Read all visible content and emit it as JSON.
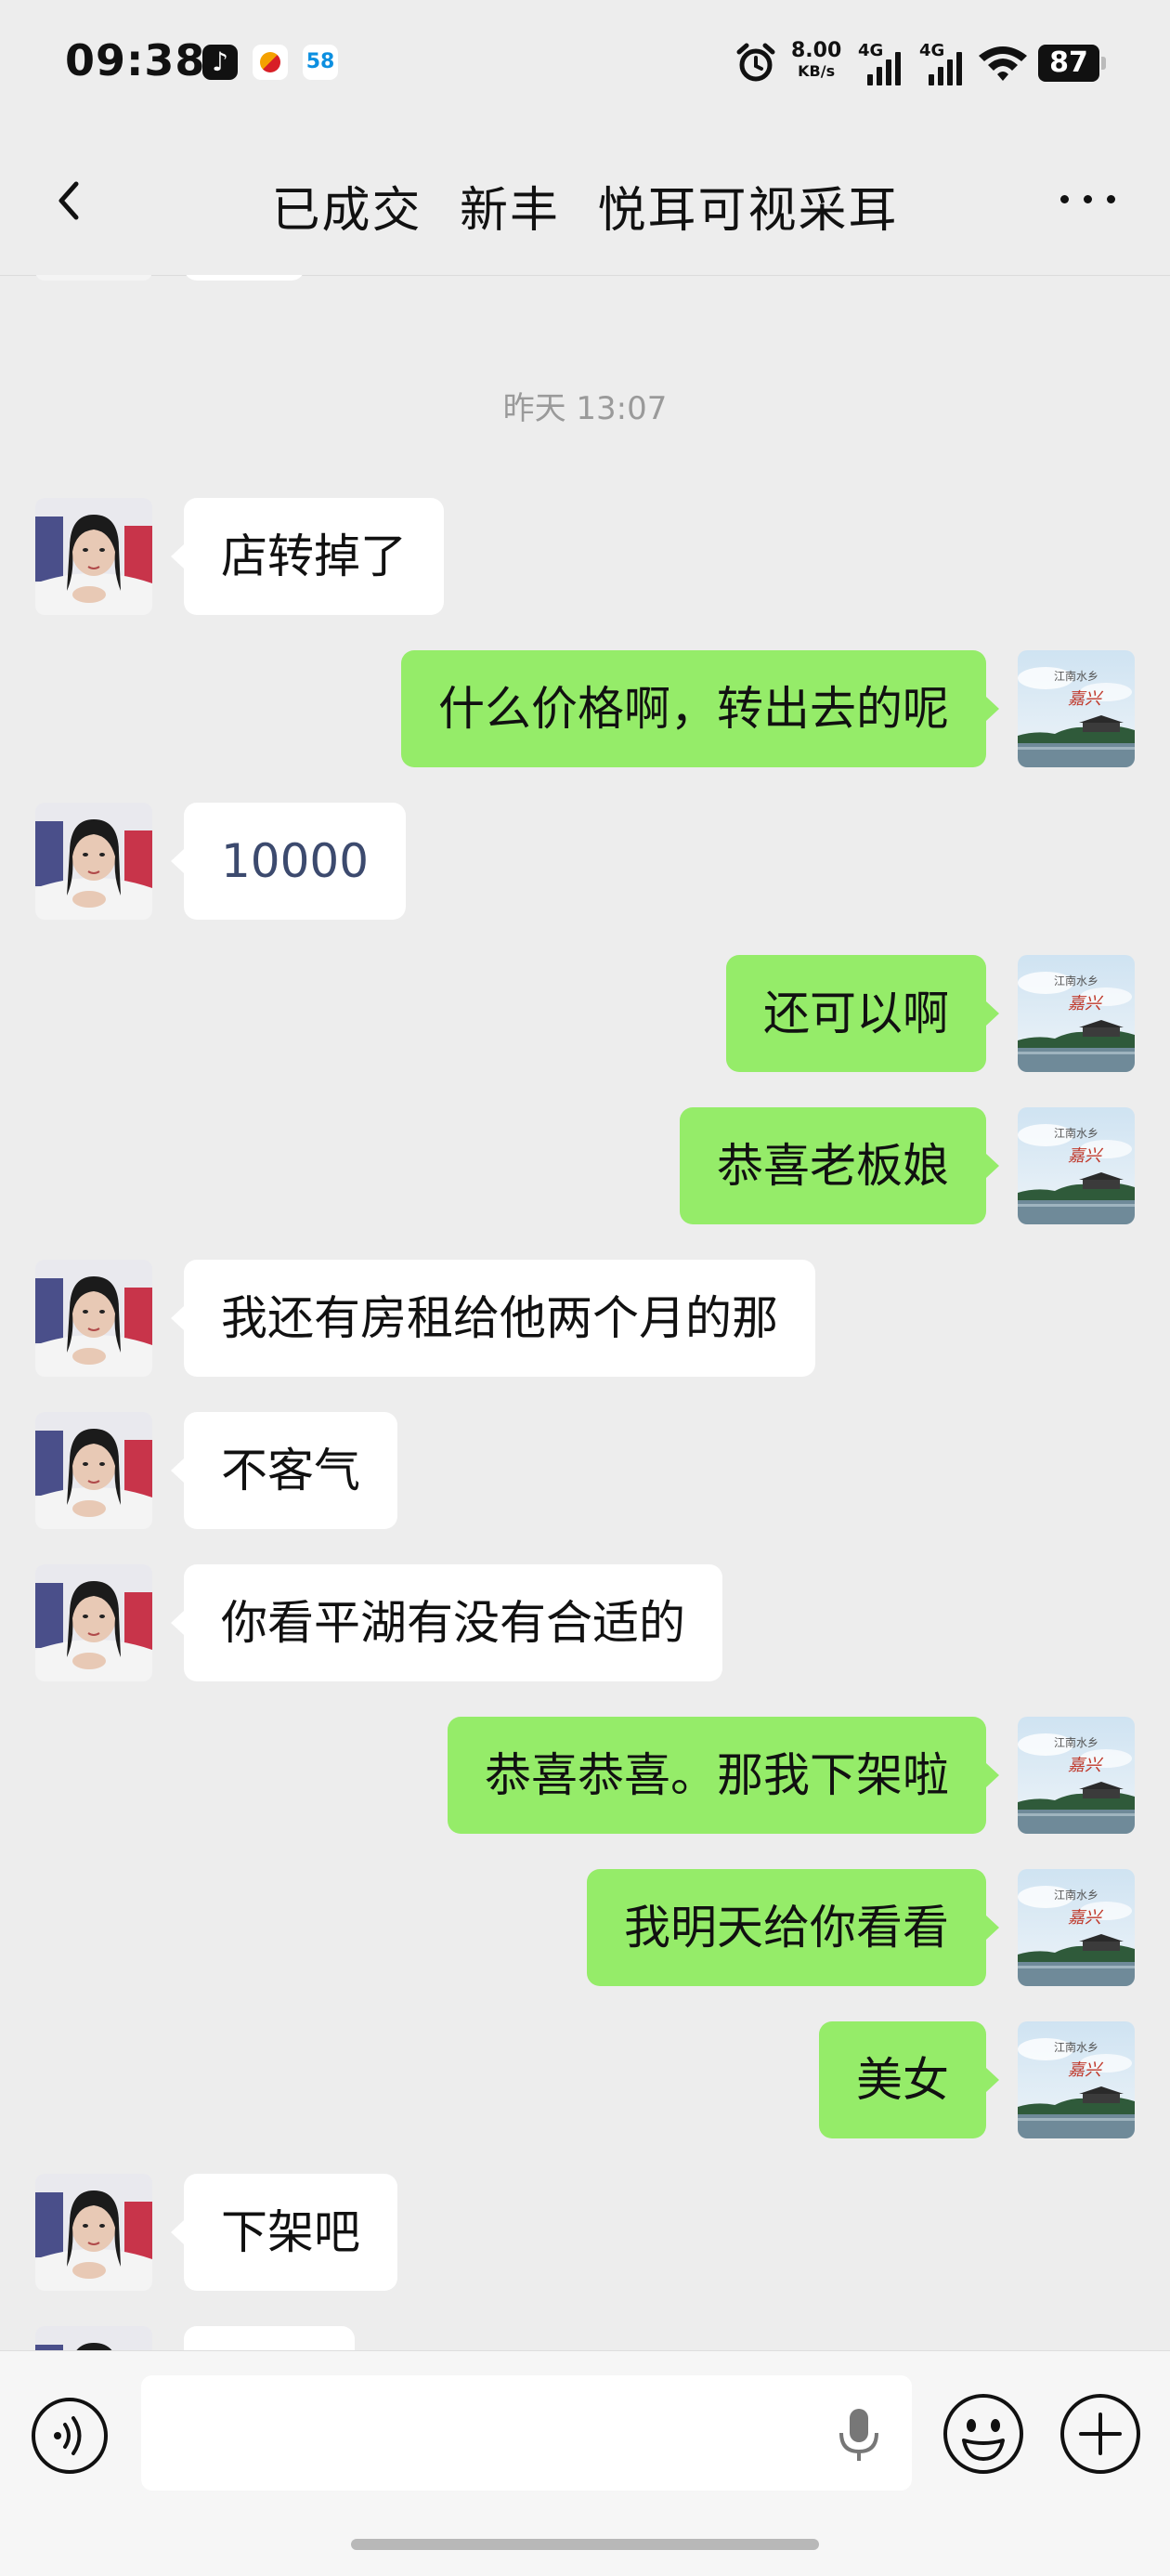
{
  "status_bar": {
    "time": "09:38",
    "net_speed": "8.00",
    "net_speed_unit": "KB/s",
    "network_1": "4G",
    "network_2": "4G",
    "battery": "87",
    "app_icons": [
      "tiktok-icon",
      "app-icon",
      "58-icon"
    ]
  },
  "header": {
    "title": "已成交 新丰 悦耳可视采耳",
    "back_icon": "chevron-left-icon",
    "more_icon": "more-dots-icon"
  },
  "chat": {
    "timestamp": "昨天 13:07",
    "messages": [
      {
        "side": "left",
        "text": "店转掉了"
      },
      {
        "side": "right",
        "text": "什么价格啊，转出去的呢"
      },
      {
        "side": "left",
        "text": "10000"
      },
      {
        "side": "right",
        "text": "还可以啊"
      },
      {
        "side": "right",
        "text": "恭喜老板娘"
      },
      {
        "side": "left",
        "text": "我还有房租给他两个月的那"
      },
      {
        "side": "left",
        "text": "不客气"
      },
      {
        "side": "left",
        "text": "你看平湖有没有合适的"
      },
      {
        "side": "right",
        "text": "恭喜恭喜。那我下架啦"
      },
      {
        "side": "right",
        "text": "我明天给你看看"
      },
      {
        "side": "right",
        "text": "美女"
      },
      {
        "side": "left",
        "text": "下架吧"
      }
    ],
    "self_avatar_text": "嘉兴",
    "self_avatar_caption": "江南水乡"
  },
  "input_bar": {
    "value": "",
    "voice_icon": "voice-icon",
    "mic_icon": "microphone-icon",
    "emoji_icon": "emoji-icon",
    "plus_icon": "plus-icon"
  },
  "colors": {
    "background": "#ededed",
    "bubble_self": "#95ec69",
    "bubble_other": "#ffffff"
  }
}
